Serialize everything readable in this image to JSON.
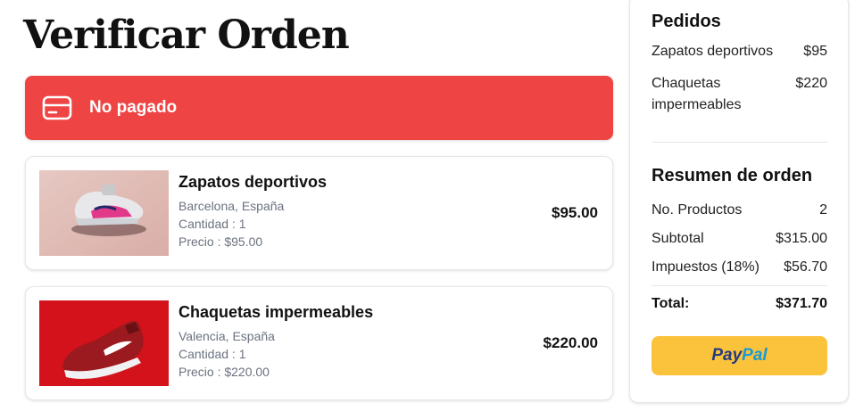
{
  "page_title": "Verificar Orden",
  "status_banner": {
    "label": "No pagado",
    "icon": "credit-card-icon",
    "color": "#ef4444"
  },
  "products": [
    {
      "name": "Zapatos deportivos",
      "location": "Barcelona, España",
      "quantity": "Cantidad : 1",
      "price_line": "Precio : $95.00",
      "total": "$95.00",
      "image": "pink-sneaker-image"
    },
    {
      "name": "Chaquetas impermeables",
      "location": "Valencia, España",
      "quantity": "Cantidad : 1",
      "price_line": "Precio : $220.00",
      "total": "$220.00",
      "image": "red-sneaker-image"
    }
  ],
  "orders": {
    "title": "Pedidos",
    "items": [
      {
        "label": "Zapatos deportivos",
        "value": "$95"
      },
      {
        "label": "Chaquetas impermeables",
        "value": "$220"
      }
    ]
  },
  "summary": {
    "title": "Resumen de orden",
    "rows": [
      {
        "label": "No. Productos",
        "value": "2"
      },
      {
        "label": "Subtotal",
        "value": "$315.00"
      },
      {
        "label": "Impuestos (18%)",
        "value": "$56.70"
      }
    ],
    "total_label": "Total:",
    "total_value": "$371.70"
  },
  "paypal": {
    "part1": "Pay",
    "part2": "Pal",
    "color": "#fbc23c"
  }
}
